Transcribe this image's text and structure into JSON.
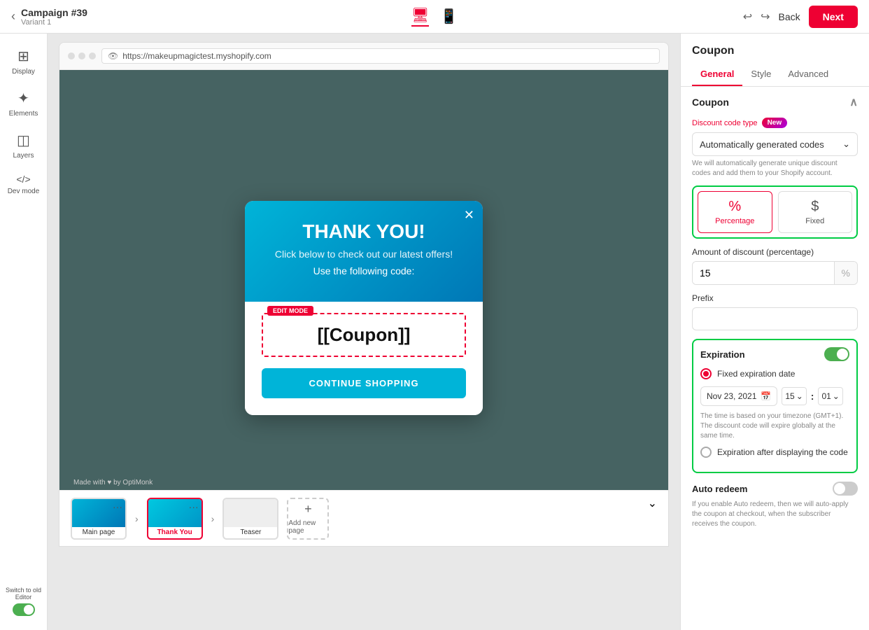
{
  "topBar": {
    "back_arrow": "‹",
    "campaign_title": "Campaign #39",
    "variant": "Variant 1",
    "device_desktop": "🖥",
    "device_mobile": "📱",
    "back_label": "Back",
    "next_label": "Next",
    "undo": "↩",
    "redo": "↪"
  },
  "sidebar": {
    "items": [
      {
        "id": "display",
        "icon": "⊞",
        "label": "Display"
      },
      {
        "id": "elements",
        "icon": "✦",
        "label": "Elements"
      },
      {
        "id": "layers",
        "icon": "◫",
        "label": "Layers"
      },
      {
        "id": "devmode",
        "icon": "</>",
        "label": "Dev mode"
      }
    ],
    "switch_label": "Switch to old Editor",
    "toggle_state": "on"
  },
  "browser": {
    "url": "https://makeupmagictest.myshopify.com",
    "dots": [
      "⬤",
      "⬤",
      "⬤"
    ]
  },
  "popup": {
    "title": "THANK YOU!",
    "subtitle": "Click below to check out our latest offers!",
    "code_label": "Use the following code:",
    "edit_mode_badge": "EDIT MODE",
    "coupon_placeholder": "[[Coupon]]",
    "continue_btn": "CONTINUE SHOPPING",
    "close": "✕"
  },
  "pages_bar": {
    "pages": [
      {
        "id": "main",
        "label": "Main page",
        "active": false
      },
      {
        "id": "thankyou",
        "label": "Thank You",
        "active": true
      },
      {
        "id": "teaser",
        "label": "Teaser",
        "active": false
      }
    ],
    "add_label": "Add new page",
    "add_icon": "+"
  },
  "made_with": "Made with ♥ by OptiMonk",
  "rightPanel": {
    "title": "Coupon",
    "tabs": [
      {
        "id": "general",
        "label": "General",
        "active": true
      },
      {
        "id": "style",
        "label": "Style",
        "active": false
      },
      {
        "id": "advanced",
        "label": "Advanced",
        "active": false
      }
    ],
    "coupon_section": {
      "title": "Coupon",
      "discount_code_label": "Discount code type",
      "new_badge": "New",
      "selected_option": "Automatically generated codes",
      "chevron": "⌄",
      "help_text": "We will automatically generate unique discount codes and add them to your Shopify account.",
      "discount_type_percentage_icon": "%",
      "discount_type_percentage_label": "Percentage",
      "discount_type_fixed_icon": "$",
      "discount_type_fixed_label": "Fixed",
      "amount_label": "Amount of discount (percentage)",
      "amount_value": "15",
      "amount_suffix": "%",
      "prefix_label": "Prefix",
      "prefix_value": ""
    },
    "expiration": {
      "label": "Expiration",
      "toggle": "on",
      "fixed_date_label": "Fixed expiration date",
      "date_value": "Nov 23, 2021",
      "calendar_icon": "📅",
      "hour_value": "15",
      "minute_value": "01",
      "chevron": "⌄",
      "help_text": "The time is based on your timezone (GMT+1). The discount code will expire globally at the same time.",
      "after_display_label": "Expiration after displaying the code"
    },
    "auto_redeem": {
      "label": "Auto redeem",
      "toggle": "off",
      "help_text": "If you enable Auto redeem, then we will auto-apply the coupon at checkout, when the subscriber receives the coupon."
    }
  }
}
